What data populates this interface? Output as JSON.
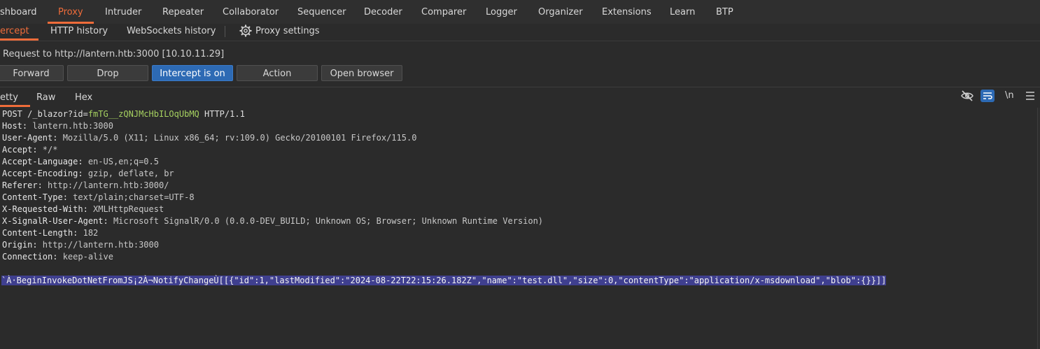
{
  "top_tabs": [
    "shboard",
    "Proxy",
    "Intruder",
    "Repeater",
    "Collaborator",
    "Sequencer",
    "Decoder",
    "Comparer",
    "Logger",
    "Organizer",
    "Extensions",
    "Learn",
    "BTP"
  ],
  "sub_tabs": [
    "ercept",
    "HTTP history",
    "WebSockets history"
  ],
  "proxy_settings_label": "Proxy settings",
  "request_to": "Request to http://lantern.htb:3000  [10.10.11.29]",
  "buttons": {
    "forward": "Forward",
    "drop": "Drop",
    "intercept": "Intercept is on",
    "action": "Action",
    "open_browser": "Open browser"
  },
  "editor_tabs": [
    "etty",
    "Raw",
    "Hex"
  ],
  "newline_toggle": "\\n",
  "request": {
    "line_prefix": "POST /_blazor?id=",
    "id_param": "fmTG__zQNJMcHbILOqUbMQ",
    "line_suffix": " HTTP/1.1",
    "headers": [
      {
        "name": "Host:",
        "value": " lantern.htb:3000"
      },
      {
        "name": "User-Agent:",
        "value": " Mozilla/5.0 (X11; Linux x86_64; rv:109.0) Gecko/20100101 Firefox/115.0"
      },
      {
        "name": "Accept:",
        "value": " */*"
      },
      {
        "name": "Accept-Language:",
        "value": " en-US,en;q=0.5"
      },
      {
        "name": "Accept-Encoding:",
        "value": " gzip, deflate, br"
      },
      {
        "name": "Referer:",
        "value": " http://lantern.htb:3000/"
      },
      {
        "name": "Content-Type:",
        "value": " text/plain;charset=UTF-8"
      },
      {
        "name": "X-Requested-With:",
        "value": " XMLHttpRequest"
      },
      {
        "name": "X-SignalR-User-Agent:",
        "value": " Microsoft SignalR/0.0 (0.0.0-DEV_BUILD; Unknown OS; Browser; Unknown Runtime Version)"
      },
      {
        "name": "Content-Length:",
        "value": " 182"
      },
      {
        "name": "Origin:",
        "value": " http://lantern.htb:3000"
      },
      {
        "name": "Connection:",
        "value": " keep-alive"
      }
    ],
    "body": "`À·BeginInvokeDotNetFromJS¡2À¬NotifyChangeÙ[[{\"id\":1,\"lastModified\":\"2024-08-22T22:15:26.182Z\",\"name\":\"test.dll\",\"size\":0,\"contentType\":\"application/x-msdownload\",\"blob\":{}}]]"
  },
  "colors": {
    "accent": "#ef6c3a",
    "primary_button": "#2d6ab4",
    "selection": "#3f3f8f",
    "param": "#a6d160"
  },
  "icons": [
    "gear-icon",
    "hide-eye-icon",
    "wrap-lines-icon",
    "menu-icon"
  ]
}
